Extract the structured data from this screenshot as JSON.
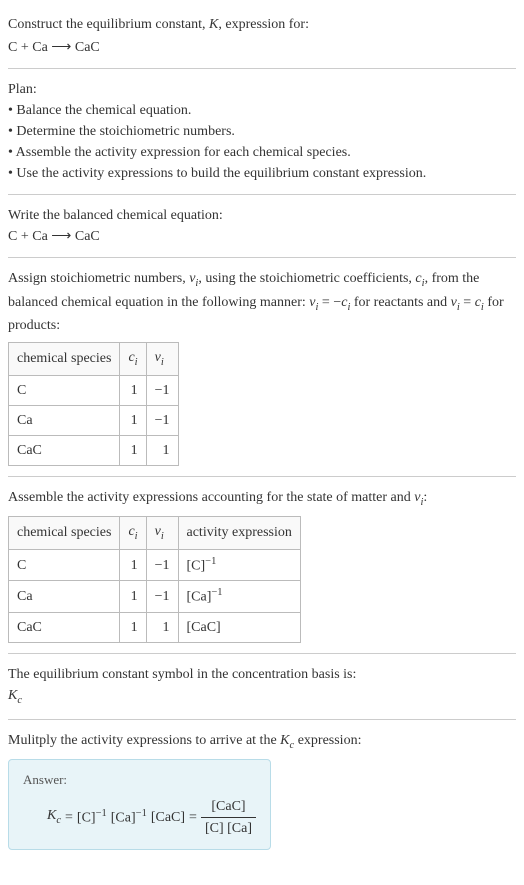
{
  "header": {
    "title": "Construct the equilibrium constant, K, expression for:",
    "equation": "C + Ca ⟶ CaC"
  },
  "plan": {
    "title": "Plan:",
    "items": [
      "Balance the chemical equation.",
      "Determine the stoichiometric numbers.",
      "Assemble the activity expression for each chemical species.",
      "Use the activity expressions to build the equilibrium constant expression."
    ]
  },
  "balanced": {
    "title": "Write the balanced chemical equation:",
    "equation": "C + Ca ⟶ CaC"
  },
  "stoich": {
    "intro_a": "Assign stoichiometric numbers, ",
    "nu": "ν",
    "sub_i": "i",
    "intro_b": ", using the stoichiometric coefficients, ",
    "c": "c",
    "intro_c": ", from the balanced chemical equation in the following manner: ",
    "rule_react": " = −",
    "intro_d": " for reactants and ",
    "rule_prod": " = ",
    "intro_e": " for products:",
    "headers": {
      "species": "chemical species",
      "ci": "c",
      "nui": "ν"
    },
    "rows": [
      {
        "species": "C",
        "ci": "1",
        "nui": "−1"
      },
      {
        "species": "Ca",
        "ci": "1",
        "nui": "−1"
      },
      {
        "species": "CaC",
        "ci": "1",
        "nui": "1"
      }
    ]
  },
  "activity": {
    "title_a": "Assemble the activity expressions accounting for the state of matter and ",
    "title_b": ":",
    "headers": {
      "species": "chemical species",
      "ci": "c",
      "nui": "ν",
      "expr": "activity expression"
    },
    "rows": [
      {
        "species": "C",
        "ci": "1",
        "nui": "−1",
        "expr_base": "[C]",
        "expr_sup": "−1"
      },
      {
        "species": "Ca",
        "ci": "1",
        "nui": "−1",
        "expr_base": "[Ca]",
        "expr_sup": "−1"
      },
      {
        "species": "CaC",
        "ci": "1",
        "nui": "1",
        "expr_base": "[CaC]",
        "expr_sup": ""
      }
    ]
  },
  "symbol": {
    "title": "The equilibrium constant symbol in the concentration basis is:",
    "K": "K",
    "sub_c": "c"
  },
  "multiply": {
    "title_a": "Mulitply the activity expressions to arrive at the ",
    "title_b": " expression:"
  },
  "answer": {
    "label": "Answer:",
    "K": "K",
    "sub_c": "c",
    "eq": " = ",
    "t1_base": "[C]",
    "t1_sup": "−1",
    "t2_base": "[Ca]",
    "t2_sup": "−1",
    "t3": "[CaC]",
    "frac_num": "[CaC]",
    "frac_den": "[C] [Ca]"
  }
}
